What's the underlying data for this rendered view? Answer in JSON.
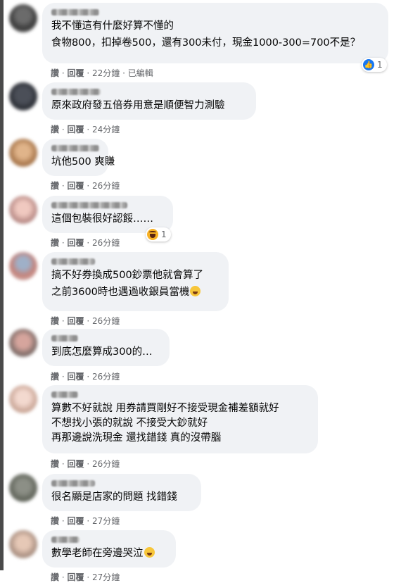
{
  "colors": {
    "bubble_bg": "#f0f2f5",
    "action_text": "#65676b",
    "like_blue": "#1877f2",
    "haha_yellow": "#f7b125"
  },
  "actions": {
    "like": "讚",
    "reply": "回覆",
    "sep": "·"
  },
  "comments": [
    {
      "lines": [
        "我不懂這有什麼好算不懂的",
        "食物800，扣掉卷500，還有300未付，現金1000-300=700不是？"
      ],
      "time": "22分鐘",
      "edited": "已編輯",
      "reaction": {
        "icon": "like-icon",
        "count": "1"
      }
    },
    {
      "lines": [
        "原來政府發五倍券用意是順便智力測驗"
      ],
      "time": "24分鐘"
    },
    {
      "lines": [
        "坑他500 爽賺"
      ],
      "time": "26分鐘"
    },
    {
      "lines": [
        "這個包裝很好認餒……"
      ],
      "time": "26分鐘",
      "reaction": {
        "icon": "haha-icon",
        "count": "1"
      }
    },
    {
      "lines": [
        "搞不好券換成500鈔票他就會算了",
        "之前3600時也遇過收銀員當機"
      ],
      "time": "26分鐘"
    },
    {
      "lines": [
        "到底怎麼算成300的…"
      ],
      "time": "26分鐘"
    },
    {
      "lines": [
        "算數不好就說 用券請買剛好不接受現金補差額就好",
        "不想找小張的就說 不接受大鈔就好",
        "再那邊說洗現金 還找錯錢 真的沒帶腦"
      ],
      "time": "26分鐘"
    },
    {
      "lines": [
        "很名顯是店家的問題 找錯錢"
      ],
      "time": "27分鐘"
    },
    {
      "lines": [
        "數學老師在旁邊哭泣"
      ],
      "time": "27分鐘"
    }
  ]
}
